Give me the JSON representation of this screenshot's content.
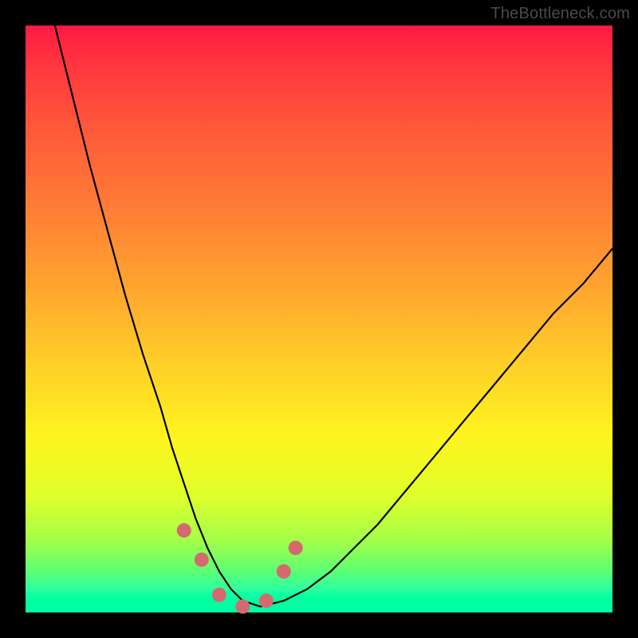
{
  "watermark": "TheBottleneck.com",
  "chart_data": {
    "type": "line",
    "title": "",
    "xlabel": "",
    "ylabel": "",
    "xlim": [
      0,
      100
    ],
    "ylim": [
      0,
      100
    ],
    "grid": false,
    "legend": false,
    "series": [
      {
        "name": "bottleneck-curve",
        "x": [
          5,
          8,
          11,
          14,
          17,
          20,
          23,
          25,
          27,
          29,
          31,
          33,
          35,
          37,
          40,
          44,
          48,
          52,
          56,
          60,
          65,
          70,
          75,
          80,
          85,
          90,
          95,
          100
        ],
        "values": [
          100,
          88,
          76,
          65,
          54,
          44,
          35,
          28,
          22,
          16,
          11,
          7,
          4,
          2,
          1,
          2,
          4,
          7,
          11,
          15,
          21,
          27,
          33,
          39,
          45,
          51,
          56,
          62
        ]
      }
    ],
    "markers": [
      {
        "name": "left-cluster-top",
        "x": 27,
        "y": 14
      },
      {
        "name": "left-cluster-mid",
        "x": 30,
        "y": 9
      },
      {
        "name": "trough-left",
        "x": 33,
        "y": 3
      },
      {
        "name": "trough-center",
        "x": 37,
        "y": 1
      },
      {
        "name": "trough-right",
        "x": 41,
        "y": 2
      },
      {
        "name": "right-cluster-low",
        "x": 44,
        "y": 7
      },
      {
        "name": "right-cluster-high",
        "x": 46,
        "y": 11
      }
    ],
    "gradient_meaning": "vertical gradient: red (top) = high bottleneck, green (bottom) = no bottleneck"
  }
}
